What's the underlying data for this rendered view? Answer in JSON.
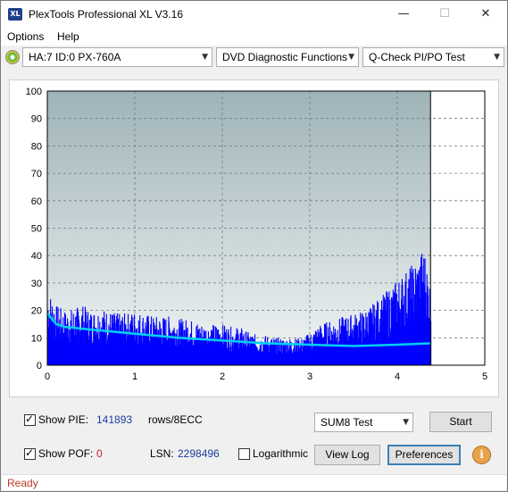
{
  "window": {
    "title": "PlexTools Professional XL V3.16",
    "icon_text": "XL"
  },
  "menu": {
    "options": "Options",
    "help": "Help"
  },
  "toolbar": {
    "drive": "HA:7 ID:0  PX-760A",
    "function": "DVD Diagnostic Functions",
    "test": "Q-Check PI/PO Test"
  },
  "chart_data": {
    "type": "bar",
    "title": "",
    "xlabel": "",
    "ylabel": "",
    "xlim": [
      0,
      5
    ],
    "ylim": [
      0,
      100
    ],
    "x_ticks": [
      "0",
      "1",
      "2",
      "3",
      "4",
      "5"
    ],
    "y_ticks": [
      "0",
      "10",
      "20",
      "30",
      "40",
      "50",
      "60",
      "70",
      "80",
      "90",
      "100"
    ],
    "grid": true,
    "data_end_x": 4.38,
    "colors": {
      "pie_bars": "#0000ff",
      "sum_line": "#00d0f0",
      "background_top": "#9eb3b8",
      "background_bottom": "#f2f5f5"
    },
    "series": [
      {
        "kind": "bars",
        "x": [
          0.0,
          0.1,
          0.2,
          0.3,
          0.4,
          0.5,
          0.6,
          0.7,
          0.8,
          0.9,
          1.0,
          1.1,
          1.2,
          1.3,
          1.4,
          1.5,
          1.6,
          1.7,
          1.8,
          1.9,
          2.0,
          2.1,
          2.2,
          2.3,
          2.4,
          2.5,
          2.6,
          2.7,
          2.8,
          2.9,
          3.0,
          3.1,
          3.2,
          3.3,
          3.4,
          3.5,
          3.6,
          3.7,
          3.8,
          3.9,
          4.0,
          4.1,
          4.2,
          4.3,
          4.38
        ],
        "values": [
          28,
          22,
          20,
          21,
          22,
          20,
          21,
          20,
          19,
          19,
          20,
          19,
          18,
          18,
          18,
          17,
          17,
          16,
          15,
          15,
          15,
          14,
          14,
          12,
          11,
          11,
          10,
          10,
          10,
          10,
          12,
          15,
          16,
          17,
          18,
          19,
          20,
          22,
          25,
          28,
          32,
          35,
          38,
          44,
          28
        ]
      },
      {
        "kind": "line",
        "x": [
          0.0,
          0.05,
          0.1,
          0.2,
          0.5,
          1.0,
          1.5,
          2.0,
          2.5,
          3.0,
          3.5,
          4.0,
          4.38
        ],
        "values": [
          19,
          17,
          15,
          14,
          13,
          11.5,
          10,
          9,
          8,
          7.5,
          7,
          7.5,
          8
        ]
      }
    ]
  },
  "bottom": {
    "show_pie_label": "Show PIE:",
    "pie_value": "141893",
    "pie_unit": "rows/8ECC",
    "show_pof_label": "Show POF:",
    "pof_value": "0",
    "lsn_label": "LSN:",
    "lsn_value": "2298496",
    "logarithmic_label": "Logarithmic",
    "test_select": "SUM8 Test",
    "start_button": "Start",
    "view_log_button": "View Log",
    "preferences_button": "Preferences",
    "info_icon_text": "i"
  },
  "status": {
    "text": "Ready"
  }
}
